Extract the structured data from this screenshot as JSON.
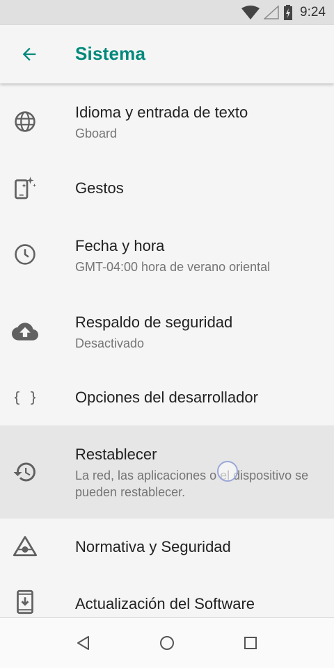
{
  "status_bar": {
    "time": "9:24",
    "icons": [
      "wifi-icon",
      "cell-signal-icon",
      "battery-icon"
    ]
  },
  "app_bar": {
    "title": "Sistema",
    "back_icon": "arrow-back-icon",
    "title_color": "#00897b"
  },
  "items": [
    {
      "title": "Idioma y entrada de texto",
      "subtitle": "Gboard",
      "icon": "globe-icon"
    },
    {
      "title": "Gestos",
      "subtitle": "",
      "icon": "gesture-phone-icon"
    },
    {
      "title": "Fecha y hora",
      "subtitle": "GMT-04:00 hora de verano oriental",
      "icon": "clock-icon"
    },
    {
      "title": "Respaldo de seguridad",
      "subtitle": "Desactivado",
      "icon": "cloud-upload-icon"
    },
    {
      "title": "Opciones del desarrollador",
      "subtitle": "",
      "icon": "braces-icon"
    },
    {
      "title": "Restablecer",
      "subtitle": "La red, las aplicaciones o el dispositivo se pueden restablecer.",
      "icon": "restore-icon",
      "highlighted": true
    },
    {
      "title": "Normativa y Seguridad",
      "subtitle": "",
      "icon": "regulatory-triangle-icon"
    },
    {
      "title": "Actualización del Software",
      "subtitle": "",
      "icon": "system-update-icon"
    }
  ],
  "nav_bar": {
    "buttons": [
      "back-triangle-icon",
      "home-circle-icon",
      "recents-square-icon"
    ]
  }
}
